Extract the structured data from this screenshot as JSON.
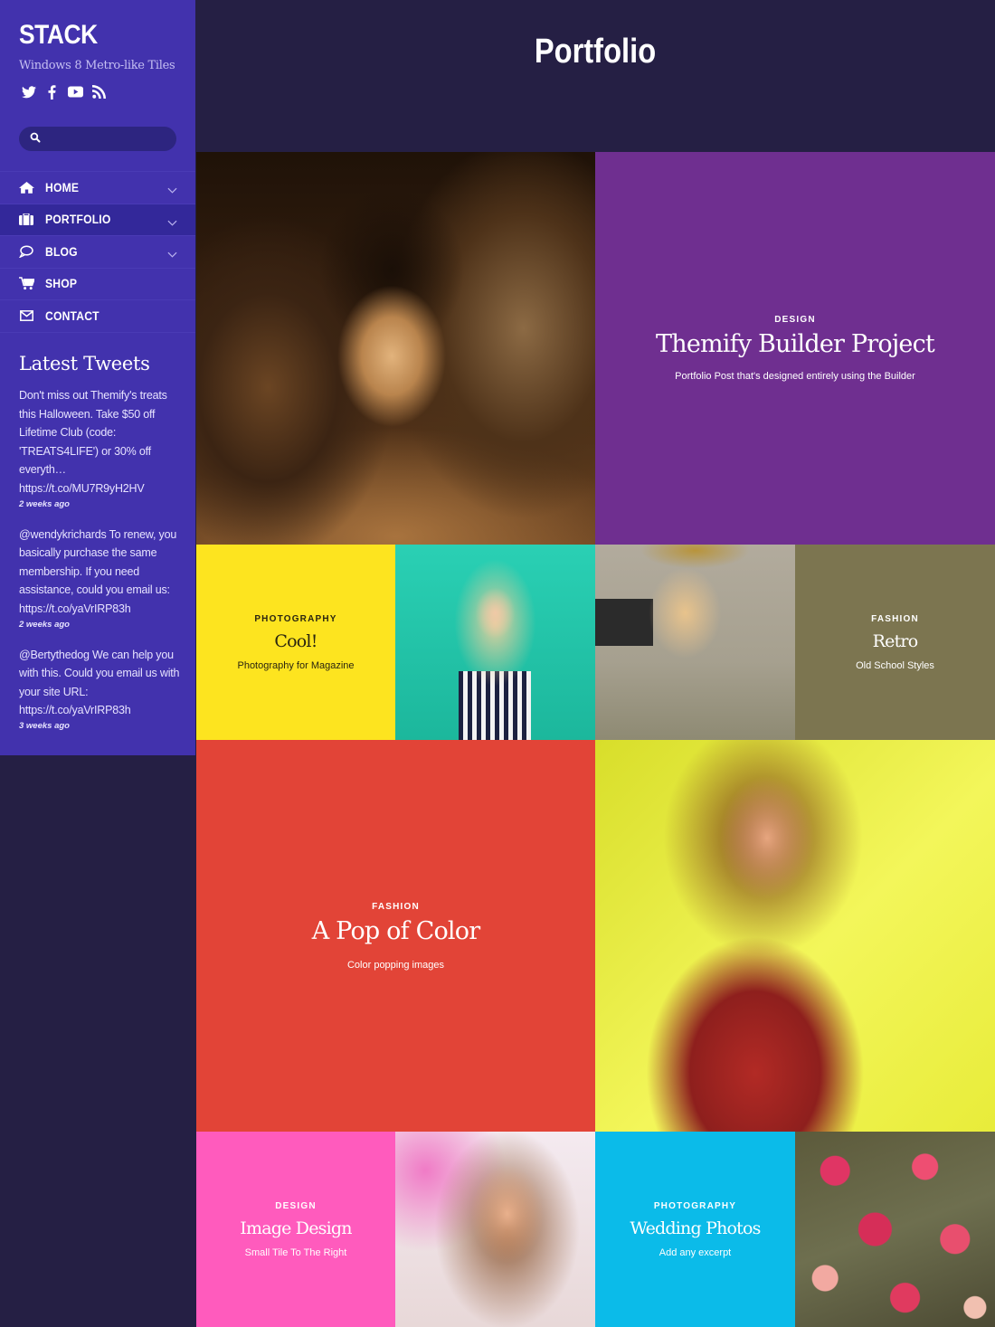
{
  "site": {
    "logo": "STACK",
    "tagline": "Windows 8 Metro-like Tiles",
    "social": [
      "twitter-icon",
      "facebook-icon",
      "youtube-icon",
      "rss-icon"
    ]
  },
  "search": {
    "placeholder": "",
    "value": ""
  },
  "nav": {
    "items": [
      {
        "label": "HOME",
        "icon": "home-icon",
        "has_submenu": true,
        "active": false
      },
      {
        "label": "PORTFOLIO",
        "icon": "briefcase-icon",
        "has_submenu": true,
        "active": true
      },
      {
        "label": "BLOG",
        "icon": "comment-icon",
        "has_submenu": true,
        "active": false
      },
      {
        "label": "SHOP",
        "icon": "cart-icon",
        "has_submenu": false,
        "active": false
      },
      {
        "label": "CONTACT",
        "icon": "envelope-icon",
        "has_submenu": false,
        "active": false
      }
    ]
  },
  "tweets": {
    "title": "Latest Tweets",
    "items": [
      {
        "text": "Don't miss out Themify's treats this Halloween. Take $50 off Lifetime Club (code: 'TREATS4LIFE') or 30% off everyth… https://t.co/MU7R9yH2HV",
        "time": "2 weeks ago"
      },
      {
        "text": "@wendykrichards To renew, you basically purchase the same membership. If you need assistance, could you email us: https://t.co/yaVrIRP83h",
        "time": "2 weeks ago"
      },
      {
        "text": "@Bertythedog We can help you with this. Could you email us with your site URL: https://t.co/yaVrIRP83h",
        "time": "3 weeks ago"
      }
    ]
  },
  "header": {
    "title": "Portfolio"
  },
  "tiles": {
    "builder": {
      "category": "DESIGN",
      "title": "Themify Builder Project",
      "excerpt": "Portfolio Post that's designed entirely using the Builder",
      "color": "#6f2f90"
    },
    "cool": {
      "category": "PHOTOGRAPHY",
      "title": "Cool!",
      "excerpt": "Photography for Magazine",
      "color": "#fde41f"
    },
    "retro": {
      "category": "FASHION",
      "title": "Retro",
      "excerpt": "Old School Styles",
      "color": "#7c7550"
    },
    "pop": {
      "category": "FASHION",
      "title": "A Pop of Color",
      "excerpt": "Color popping images",
      "color": "#e24437"
    },
    "image_design": {
      "category": "DESIGN",
      "title": "Image Design",
      "excerpt": "Small Tile To The Right",
      "color": "#ff5bbd"
    },
    "wedding": {
      "category": "PHOTOGRAPHY",
      "title": "Wedding Photos",
      "excerpt": "Add any excerpt",
      "color": "#0bbbe9"
    }
  },
  "images": [
    "woman-with-golden-feathers-image",
    "woman-with-sunglasses-image",
    "woman-with-polaroid-camera-image",
    "woman-in-red-smiling-image",
    "woman-portrait-image",
    "roses-image"
  ]
}
